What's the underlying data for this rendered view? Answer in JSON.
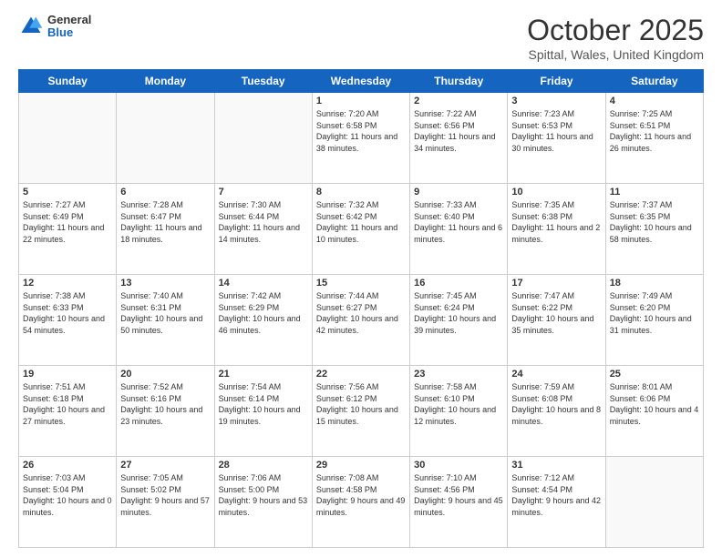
{
  "header": {
    "logo_general": "General",
    "logo_blue": "Blue",
    "month_title": "October 2025",
    "subtitle": "Spittal, Wales, United Kingdom"
  },
  "days_of_week": [
    "Sunday",
    "Monday",
    "Tuesday",
    "Wednesday",
    "Thursday",
    "Friday",
    "Saturday"
  ],
  "weeks": [
    [
      {
        "day": "",
        "info": ""
      },
      {
        "day": "",
        "info": ""
      },
      {
        "day": "",
        "info": ""
      },
      {
        "day": "1",
        "info": "Sunrise: 7:20 AM\nSunset: 6:58 PM\nDaylight: 11 hours and 38 minutes."
      },
      {
        "day": "2",
        "info": "Sunrise: 7:22 AM\nSunset: 6:56 PM\nDaylight: 11 hours and 34 minutes."
      },
      {
        "day": "3",
        "info": "Sunrise: 7:23 AM\nSunset: 6:53 PM\nDaylight: 11 hours and 30 minutes."
      },
      {
        "day": "4",
        "info": "Sunrise: 7:25 AM\nSunset: 6:51 PM\nDaylight: 11 hours and 26 minutes."
      }
    ],
    [
      {
        "day": "5",
        "info": "Sunrise: 7:27 AM\nSunset: 6:49 PM\nDaylight: 11 hours and 22 minutes."
      },
      {
        "day": "6",
        "info": "Sunrise: 7:28 AM\nSunset: 6:47 PM\nDaylight: 11 hours and 18 minutes."
      },
      {
        "day": "7",
        "info": "Sunrise: 7:30 AM\nSunset: 6:44 PM\nDaylight: 11 hours and 14 minutes."
      },
      {
        "day": "8",
        "info": "Sunrise: 7:32 AM\nSunset: 6:42 PM\nDaylight: 11 hours and 10 minutes."
      },
      {
        "day": "9",
        "info": "Sunrise: 7:33 AM\nSunset: 6:40 PM\nDaylight: 11 hours and 6 minutes."
      },
      {
        "day": "10",
        "info": "Sunrise: 7:35 AM\nSunset: 6:38 PM\nDaylight: 11 hours and 2 minutes."
      },
      {
        "day": "11",
        "info": "Sunrise: 7:37 AM\nSunset: 6:35 PM\nDaylight: 10 hours and 58 minutes."
      }
    ],
    [
      {
        "day": "12",
        "info": "Sunrise: 7:38 AM\nSunset: 6:33 PM\nDaylight: 10 hours and 54 minutes."
      },
      {
        "day": "13",
        "info": "Sunrise: 7:40 AM\nSunset: 6:31 PM\nDaylight: 10 hours and 50 minutes."
      },
      {
        "day": "14",
        "info": "Sunrise: 7:42 AM\nSunset: 6:29 PM\nDaylight: 10 hours and 46 minutes."
      },
      {
        "day": "15",
        "info": "Sunrise: 7:44 AM\nSunset: 6:27 PM\nDaylight: 10 hours and 42 minutes."
      },
      {
        "day": "16",
        "info": "Sunrise: 7:45 AM\nSunset: 6:24 PM\nDaylight: 10 hours and 39 minutes."
      },
      {
        "day": "17",
        "info": "Sunrise: 7:47 AM\nSunset: 6:22 PM\nDaylight: 10 hours and 35 minutes."
      },
      {
        "day": "18",
        "info": "Sunrise: 7:49 AM\nSunset: 6:20 PM\nDaylight: 10 hours and 31 minutes."
      }
    ],
    [
      {
        "day": "19",
        "info": "Sunrise: 7:51 AM\nSunset: 6:18 PM\nDaylight: 10 hours and 27 minutes."
      },
      {
        "day": "20",
        "info": "Sunrise: 7:52 AM\nSunset: 6:16 PM\nDaylight: 10 hours and 23 minutes."
      },
      {
        "day": "21",
        "info": "Sunrise: 7:54 AM\nSunset: 6:14 PM\nDaylight: 10 hours and 19 minutes."
      },
      {
        "day": "22",
        "info": "Sunrise: 7:56 AM\nSunset: 6:12 PM\nDaylight: 10 hours and 15 minutes."
      },
      {
        "day": "23",
        "info": "Sunrise: 7:58 AM\nSunset: 6:10 PM\nDaylight: 10 hours and 12 minutes."
      },
      {
        "day": "24",
        "info": "Sunrise: 7:59 AM\nSunset: 6:08 PM\nDaylight: 10 hours and 8 minutes."
      },
      {
        "day": "25",
        "info": "Sunrise: 8:01 AM\nSunset: 6:06 PM\nDaylight: 10 hours and 4 minutes."
      }
    ],
    [
      {
        "day": "26",
        "info": "Sunrise: 7:03 AM\nSunset: 5:04 PM\nDaylight: 10 hours and 0 minutes."
      },
      {
        "day": "27",
        "info": "Sunrise: 7:05 AM\nSunset: 5:02 PM\nDaylight: 9 hours and 57 minutes."
      },
      {
        "day": "28",
        "info": "Sunrise: 7:06 AM\nSunset: 5:00 PM\nDaylight: 9 hours and 53 minutes."
      },
      {
        "day": "29",
        "info": "Sunrise: 7:08 AM\nSunset: 4:58 PM\nDaylight: 9 hours and 49 minutes."
      },
      {
        "day": "30",
        "info": "Sunrise: 7:10 AM\nSunset: 4:56 PM\nDaylight: 9 hours and 45 minutes."
      },
      {
        "day": "31",
        "info": "Sunrise: 7:12 AM\nSunset: 4:54 PM\nDaylight: 9 hours and 42 minutes."
      },
      {
        "day": "",
        "info": ""
      }
    ]
  ]
}
